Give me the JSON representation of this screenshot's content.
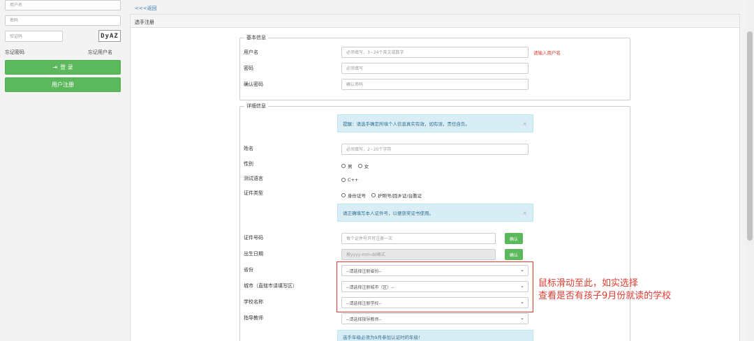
{
  "login": {
    "username_placeholder": "用户名",
    "password_placeholder": "密码",
    "captcha_placeholder": "验证码",
    "captcha_text": "DyAZ",
    "forgot_password": "忘记密码",
    "forgot_username": "忘记用户名",
    "login_button": "登 录",
    "register_button": "用户注册"
  },
  "nav": {
    "back_link": "<<<返回"
  },
  "panel_title": "选手注册",
  "basic": {
    "legend": "基本信息",
    "username_label": "用户名",
    "username_placeholder": "必须填写，3~24个英文或数字",
    "username_error": "请输入用户名",
    "password_label": "密码",
    "password_placeholder": "必须填写",
    "confirm_label": "确认密码",
    "confirm_placeholder": "确认密码"
  },
  "detail": {
    "legend": "详细信息",
    "alert1": "提醒：请选手确定所填个人信息真实有效，如有误，责任自负。",
    "name_label": "姓名",
    "name_placeholder": "必须填写，2~20个字符",
    "gender_label": "性别",
    "gender_male": "男",
    "gender_female": "女",
    "lang_label": "测试语言",
    "lang_cpp": "C++",
    "idtype_label": "证件类型",
    "idtype_id": "身份证号",
    "idtype_passport": "护照号/回乡证/台胞证",
    "alert2": "请正确填写本人证件号，以便获奖证书使用。",
    "idno_label": "证件号码",
    "idno_placeholder": "每个证件号只可注册一次",
    "confirm_btn": "确认",
    "birth_label": "出生日期",
    "birth_placeholder": "按yyyy-mm-dd格式",
    "province_label": "省份",
    "province_select": "--请选择注册省份--",
    "city_label": "城市（直辖市请填写区）",
    "city_select": "--请选择注册城市（区）--",
    "school_label": "学校名称",
    "school_select": "--请选择注册学校--",
    "teacher_label": "指导教师",
    "teacher_select": "--请选择指导教师--",
    "alert3": "选手年级必须为9月参加认证时的年级！"
  },
  "annotation": {
    "line1": "鼠标滑动至此，如实选择",
    "line2": "查看是否有孩子9月份就读的学校"
  },
  "colors": {
    "accent_green": "#5cb85c",
    "annotation_red": "#e03c31",
    "alert_blue": "#d9edf7"
  }
}
